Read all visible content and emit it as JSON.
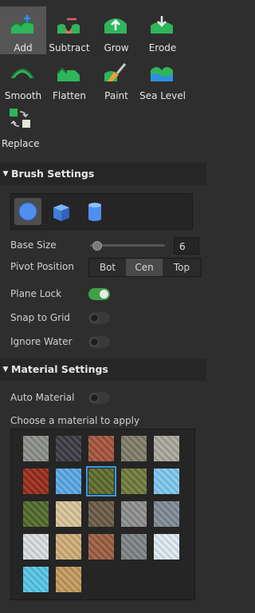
{
  "tools": [
    {
      "label": "Add",
      "icon": "add-terrain-icon",
      "selected": true
    },
    {
      "label": "Subtract",
      "icon": "subtract-terrain-icon",
      "selected": false
    },
    {
      "label": "Grow",
      "icon": "grow-terrain-icon",
      "selected": false
    },
    {
      "label": "Erode",
      "icon": "erode-terrain-icon",
      "selected": false
    },
    {
      "label": "Smooth",
      "icon": "smooth-terrain-icon",
      "selected": false
    },
    {
      "label": "Flatten",
      "icon": "flatten-terrain-icon",
      "selected": false
    },
    {
      "label": "Paint",
      "icon": "paint-terrain-icon",
      "selected": false
    },
    {
      "label": "Sea Level",
      "icon": "sea-level-icon",
      "selected": false
    },
    {
      "label": "Replace",
      "icon": "replace-terrain-icon",
      "selected": false
    }
  ],
  "brush": {
    "title": "Brush Settings",
    "shapes": [
      {
        "name": "sphere-shape-icon",
        "selected": true
      },
      {
        "name": "cube-shape-icon",
        "selected": false
      },
      {
        "name": "cylinder-shape-icon",
        "selected": false
      }
    ],
    "base_size_label": "Base Size",
    "base_size_value": "6",
    "base_size_slider_fraction": 0.03,
    "pivot_label": "Pivot Position",
    "pivot_options": [
      "Bot",
      "Cen",
      "Top"
    ],
    "pivot_selected": "Cen",
    "plane_lock_label": "Plane Lock",
    "plane_lock_on": true,
    "snap_label": "Snap to Grid",
    "snap_on": false,
    "ignore_water_label": "Ignore Water",
    "ignore_water_on": false
  },
  "material": {
    "title": "Material Settings",
    "auto_label": "Auto Material",
    "auto_on": false,
    "choose_label": "Choose a material to apply",
    "selected_index": 7,
    "materials": [
      {
        "name": "asphalt",
        "color": "#8c8f8a"
      },
      {
        "name": "basalt",
        "color": "#3c3a42"
      },
      {
        "name": "brick",
        "color": "#a4533c"
      },
      {
        "name": "cobblestone",
        "color": "#7f7d67"
      },
      {
        "name": "concrete",
        "color": "#aaa79c"
      },
      {
        "name": "cracked-lava",
        "color": "#9a2a1a"
      },
      {
        "name": "glacier",
        "color": "#5aa8e6"
      },
      {
        "name": "grass",
        "color": "#5d6a2b"
      },
      {
        "name": "ground",
        "color": "#6f7a3a"
      },
      {
        "name": "ice",
        "color": "#7fc9ee"
      },
      {
        "name": "leafy-grass",
        "color": "#4f6a2a"
      },
      {
        "name": "limestone",
        "color": "#d9c49a"
      },
      {
        "name": "mud",
        "color": "#6a5a44"
      },
      {
        "name": "pavement",
        "color": "#8d8f8d"
      },
      {
        "name": "rock",
        "color": "#7f8a95"
      },
      {
        "name": "salt",
        "color": "#d8dde0"
      },
      {
        "name": "sand",
        "color": "#cfae78"
      },
      {
        "name": "sandstone",
        "color": "#9b5e40"
      },
      {
        "name": "slate",
        "color": "#7d8286"
      },
      {
        "name": "snow",
        "color": "#dfeaf3"
      },
      {
        "name": "water",
        "color": "#56c6e6"
      },
      {
        "name": "wood-planks",
        "color": "#c49a5c"
      }
    ]
  }
}
